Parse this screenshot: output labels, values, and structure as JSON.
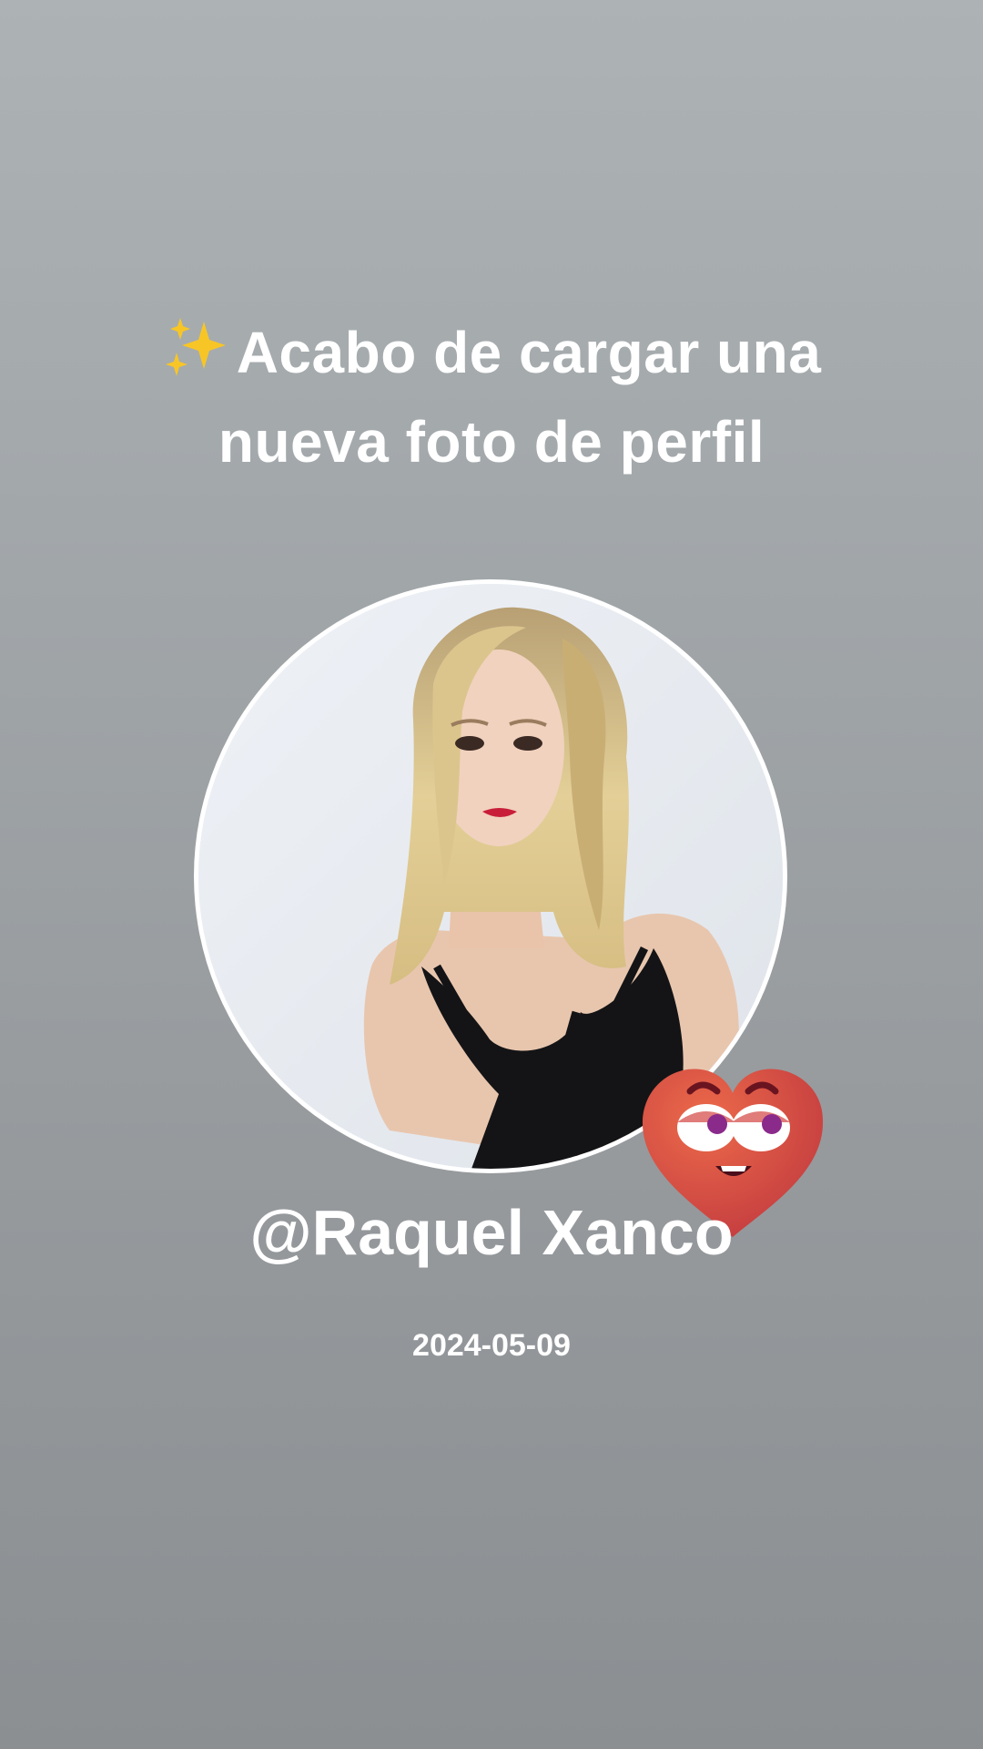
{
  "story": {
    "headline_icon": "sparkles-icon",
    "headline_line1": "Acabo de cargar una",
    "headline_line2": "nueva foto de perfil",
    "username": "@Raquel Xanco",
    "date": "2024-05-09",
    "sticker_icon": "heart-face-sticker"
  },
  "colors": {
    "background_top": "#adb3b5",
    "background_bottom": "#8b8f92",
    "text": "#ffffff",
    "heart": "#d9483d"
  }
}
